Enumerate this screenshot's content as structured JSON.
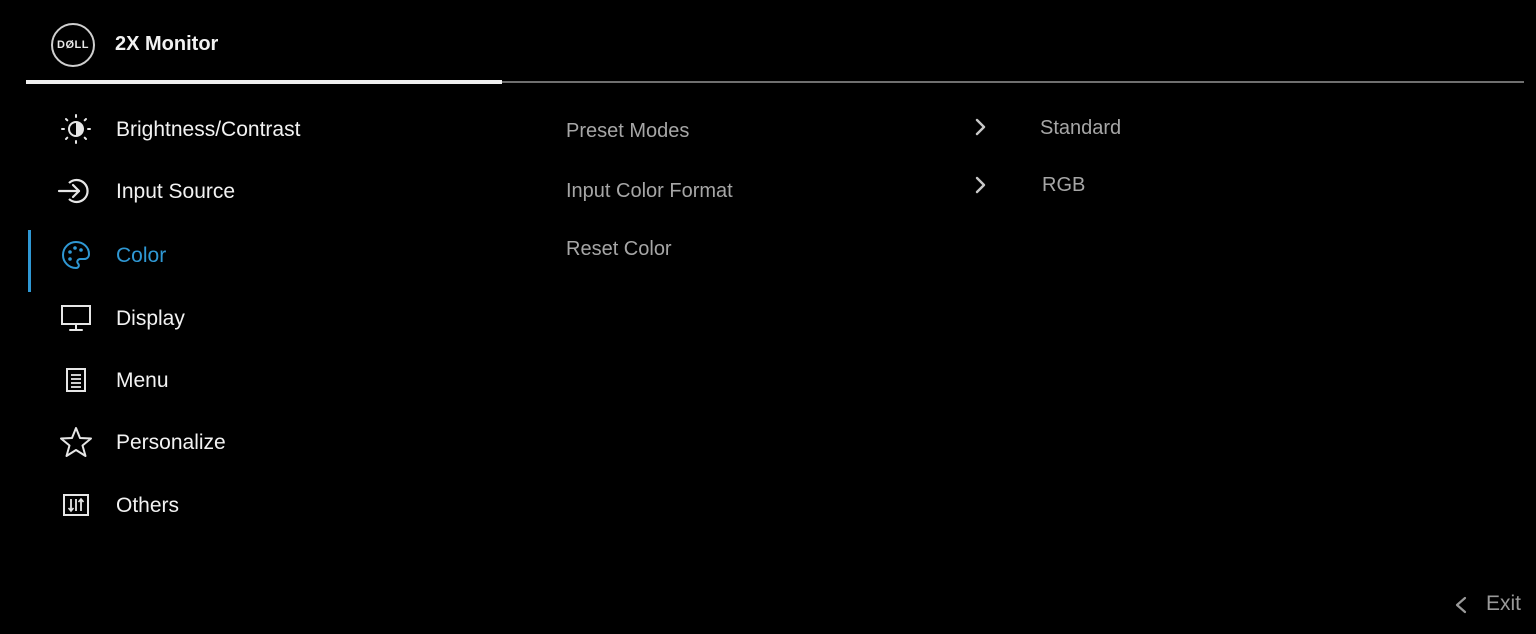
{
  "header": {
    "logo_text": "DØLL",
    "title": "2X Monitor"
  },
  "sidebar": {
    "items": [
      {
        "label": "Brightness/Contrast",
        "icon": "brightness-contrast-icon"
      },
      {
        "label": "Input Source",
        "icon": "input-source-icon"
      },
      {
        "label": "Color",
        "icon": "color-palette-icon",
        "active": true
      },
      {
        "label": "Display",
        "icon": "display-monitor-icon"
      },
      {
        "label": "Menu",
        "icon": "menu-document-icon"
      },
      {
        "label": "Personalize",
        "icon": "star-icon"
      },
      {
        "label": "Others",
        "icon": "others-sliders-icon"
      }
    ]
  },
  "color_panel": {
    "options": [
      {
        "label": "Preset Modes",
        "value": "Standard",
        "has_submenu": true
      },
      {
        "label": "Input Color Format",
        "value": "RGB",
        "has_submenu": true
      },
      {
        "label": "Reset Color",
        "value": "",
        "has_submenu": false
      }
    ]
  },
  "footer": {
    "exit_label": "Exit",
    "exit_icon": "chevron-left-icon"
  },
  "colors": {
    "background": "#000000",
    "accent": "#2f98d4",
    "text": "#f2f2f2",
    "muted_text": "#a6a6a6"
  }
}
